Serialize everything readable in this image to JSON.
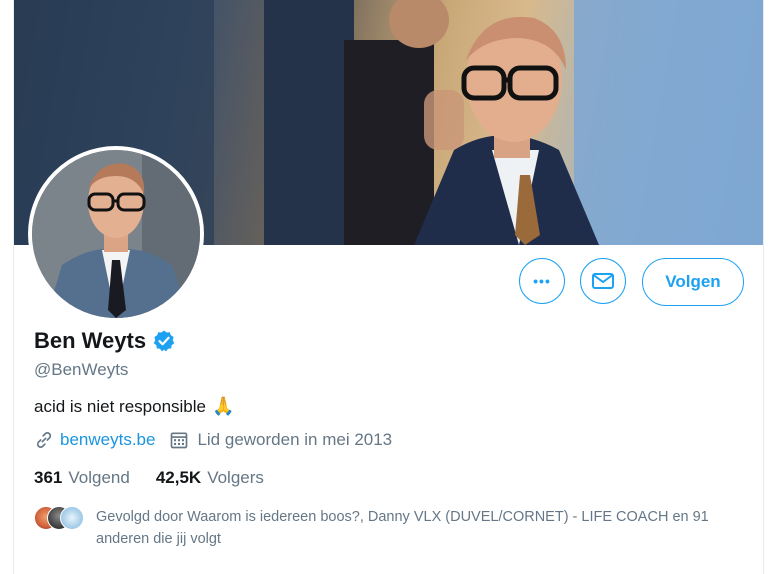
{
  "profile": {
    "name": "Ben Weyts",
    "handle": "@BenWeyts",
    "bio": "acid is niet responsible",
    "bio_emoji": "🙏",
    "website": "benweyts.be",
    "joined": "Lid geworden in mei 2013",
    "following_count": "361",
    "following_label": "Volgend",
    "followers_count": "42,5K",
    "followers_label": "Volgers",
    "followed_by": "Gevolgd door Waarom is iedereen boos?, Danny VLX (DUVEL/CORNET) - LIFE COACH en 91 anderen die jij volgt"
  },
  "actions": {
    "more_glyph": "•••",
    "follow_label": "Volgen"
  },
  "colors": {
    "accent": "#1da1f2",
    "link": "#1b95e0",
    "secondary_text": "#657786",
    "verified": "#1da1f2"
  },
  "icons": [
    "more-icon",
    "mail-icon",
    "verified-badge-icon",
    "link-icon",
    "calendar-icon"
  ]
}
